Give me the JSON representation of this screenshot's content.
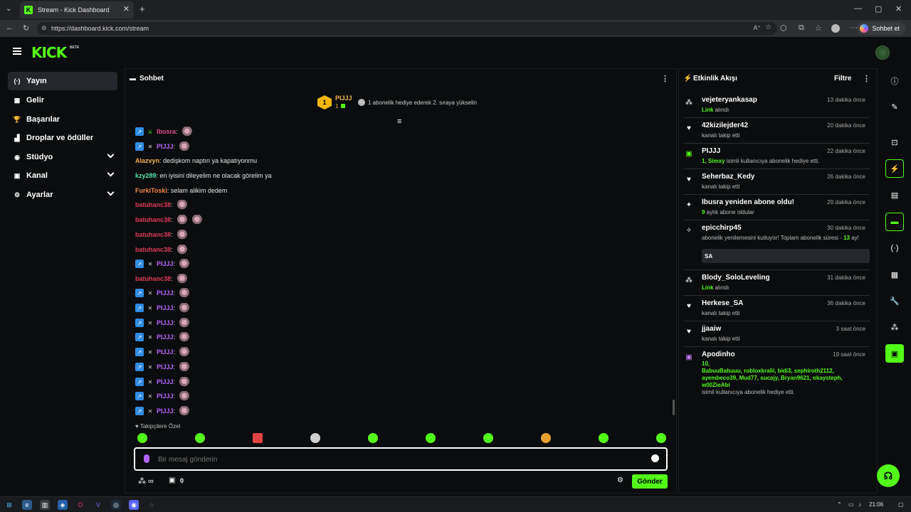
{
  "browser": {
    "tab_title": "Stream - Kick Dashboard",
    "url": "https://dashboard.kick.com/stream",
    "copilot_label": "Sohbet et"
  },
  "header": {
    "logo": "KICK",
    "beta": "BETA"
  },
  "sidebar": {
    "items": [
      {
        "label": "Yayın",
        "icon": "(·)"
      },
      {
        "label": "Gelir",
        "icon": "▦"
      },
      {
        "label": "Başarılar",
        "icon": "🏆"
      },
      {
        "label": "Droplar ve ödüller",
        "icon": "▟"
      },
      {
        "label": "Stüdyo",
        "icon": "◉"
      },
      {
        "label": "Kanal",
        "icon": "▣"
      },
      {
        "label": "Ayarlar",
        "icon": "⚙"
      }
    ]
  },
  "chat": {
    "title": "Sohbet",
    "pinned_user": "PIJJJ",
    "pinned_count": "1",
    "pinned_rank": "1",
    "pinned_text": "1 abonelik hediye ederek 2. sıraya yükselin",
    "messages": [
      {
        "user": "Ibusra",
        "text": ":",
        "color": "#e14f8d",
        "badges": "mod"
      },
      {
        "user": "PIJJJ",
        "text": ":",
        "color": "#b465ff",
        "badges": "sub"
      },
      {
        "user": "Alazvyn",
        "text": ": dedişkom naptın ya kapatıyonmu",
        "color": "#f5b44a",
        "badges": ""
      },
      {
        "user": "kzy289",
        "text": ": en iyisini dileyelim ne olacak görelim ya",
        "color": "#53e6a8",
        "badges": ""
      },
      {
        "user": "FurkiToski",
        "text": ": selam alikim dedem",
        "color": "#f5874a",
        "badges": ""
      },
      {
        "user": "batuhanc38",
        "text": ":",
        "color": "#e03b5a",
        "badges": ""
      },
      {
        "user": "batuhanc38",
        "text": ":",
        "color": "#e03b5a",
        "badges": ""
      },
      {
        "user": "batuhanc38",
        "text": ":",
        "color": "#e03b5a",
        "badges": ""
      },
      {
        "user": "batuhanc38",
        "text": ":",
        "color": "#e03b5a",
        "badges": ""
      },
      {
        "user": "PIJJJ",
        "text": ":",
        "color": "#b465ff",
        "badges": "sub"
      },
      {
        "user": "batuhanc38",
        "text": ":",
        "color": "#e03b5a",
        "badges": ""
      },
      {
        "user": "PIJJJ",
        "text": ":",
        "color": "#b465ff",
        "badges": "sub"
      },
      {
        "user": "PIJJJ",
        "text": ":",
        "color": "#b465ff",
        "badges": "sub"
      },
      {
        "user": "PIJJJ",
        "text": ":",
        "color": "#b465ff",
        "badges": "sub"
      },
      {
        "user": "PIJJJ",
        "text": ":",
        "color": "#b465ff",
        "badges": "sub"
      },
      {
        "user": "PIJJJ",
        "text": ":",
        "color": "#b465ff",
        "badges": "sub"
      },
      {
        "user": "PIJJJ",
        "text": ":",
        "color": "#b465ff",
        "badges": "sub"
      },
      {
        "user": "PIJJJ",
        "text": ":",
        "color": "#b465ff",
        "badges": "sub"
      },
      {
        "user": "PIJJJ",
        "text": ":",
        "color": "#b465ff",
        "badges": "sub"
      },
      {
        "user": "PIJJJ",
        "text": ":",
        "color": "#b465ff",
        "badges": "sub"
      }
    ],
    "followers_only": "Takipçilere Özel",
    "input_placeholder": "Bir mesaj gönderin",
    "points_value": "0",
    "send_label": "Gönder"
  },
  "activity": {
    "title": "Etkinlik Akışı",
    "filter_label": "Filtre",
    "events": [
      {
        "name": "vejeteryankasap",
        "time": "13 dakika önce",
        "sub_g": "Link",
        "sub": " alındı",
        "icon": "drops"
      },
      {
        "name": "42kizilejder42",
        "time": "20 dakika önce",
        "sub_g": "",
        "sub": "kanalı takip etti",
        "icon": "heart"
      },
      {
        "name": "PIJJJ",
        "time": "22 dakika önce",
        "sub_g": "1, Simxy",
        "sub": " isimli kullanıcıya abonelik hediye etti.",
        "icon": "gift"
      },
      {
        "name": "Seherbaz_Kedy",
        "time": "26 dakika önce",
        "sub_g": "",
        "sub": "kanalı takip etti",
        "icon": "heart"
      },
      {
        "name": "Ibusra yeniden abone oldu!",
        "time": "29 dakika önce",
        "sub_g": "9",
        "sub": " aylık abone oldular",
        "icon": "sparkle"
      },
      {
        "name": "epicchirp45",
        "time": "30 dakika önce",
        "sub_g": "",
        "sub": "abonelik yenilemesini kutluyor! Toplam abonelik süresi - ",
        "sub_g2": "13",
        "sub2": "ay!",
        "message": "SA",
        "icon": "party"
      },
      {
        "name": "Blody_SoloLeveling",
        "time": "31 dakika önce",
        "sub_g": "Link",
        "sub": " alındı",
        "icon": "drops"
      },
      {
        "name": "Herkese_SA",
        "time": "36 dakika önce",
        "sub_g": "",
        "sub": "kanalı takip etti",
        "icon": "heart"
      },
      {
        "name": "jjaaiw",
        "time": "3 saat önce",
        "sub_g": "",
        "sub": "kanalı takip etti",
        "icon": "heart"
      },
      {
        "name": "Apodinho",
        "time": "19 saat önce",
        "gift_list_1": "10,",
        "gift_list_2": "BabuuBabuuu, robloxkralii, bidi3, sephiroth2112,",
        "gift_list_3": "ayembeco39, Mud77, sucajy, Bryan9621, okaysteph,",
        "gift_list_4": "w00ZieAbi",
        "sub": "isimli kullanıcıya abonelik hediye etti.",
        "icon": "gift-purple"
      }
    ]
  },
  "taskbar": {
    "time": "21:06"
  },
  "colors": {
    "accent": "#53fc18",
    "bg": "#0b0c0d"
  }
}
